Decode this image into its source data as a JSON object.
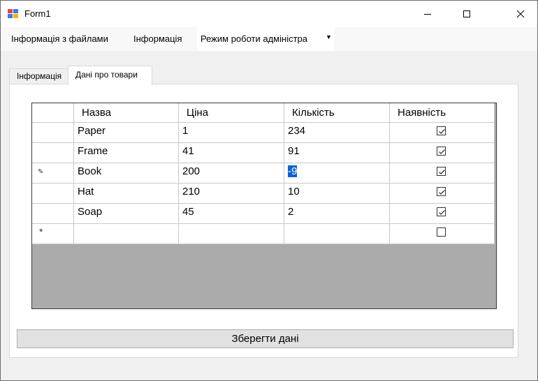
{
  "window": {
    "title": "Form1",
    "icon": "winforms-app-icon"
  },
  "menu": {
    "items": [
      {
        "label": "Інформація з файлами"
      },
      {
        "label": "Інформація"
      }
    ],
    "combo": {
      "value": "Режим роботи адміністра",
      "icon": "dropdown-arrow-icon"
    }
  },
  "tabs": [
    {
      "label": "Інформація",
      "selected": false
    },
    {
      "label": "Дані про товари",
      "selected": true
    }
  ],
  "grid": {
    "columns": [
      "Назва",
      "Ціна",
      "Кількість",
      "Наявність"
    ],
    "rows": [
      {
        "name": "Paper",
        "price": "1",
        "qty": "234",
        "available": true,
        "indicator": ""
      },
      {
        "name": "Frame",
        "price": "41",
        "qty": "91",
        "available": true,
        "indicator": ""
      },
      {
        "name": "Book",
        "price": "200",
        "qty": "-9",
        "available": true,
        "indicator": "pencil-icon",
        "editing": true
      },
      {
        "name": "Hat",
        "price": "210",
        "qty": "10",
        "available": true,
        "indicator": ""
      },
      {
        "name": "Soap",
        "price": "45",
        "qty": "2",
        "available": true,
        "indicator": ""
      }
    ],
    "new_row_indicator": "*"
  },
  "save_button": {
    "label": "Зберегти дані"
  },
  "colors": {
    "selection": "#0a64d0",
    "grid_background": "#ababab",
    "window_bg": "#f0f0f0"
  }
}
